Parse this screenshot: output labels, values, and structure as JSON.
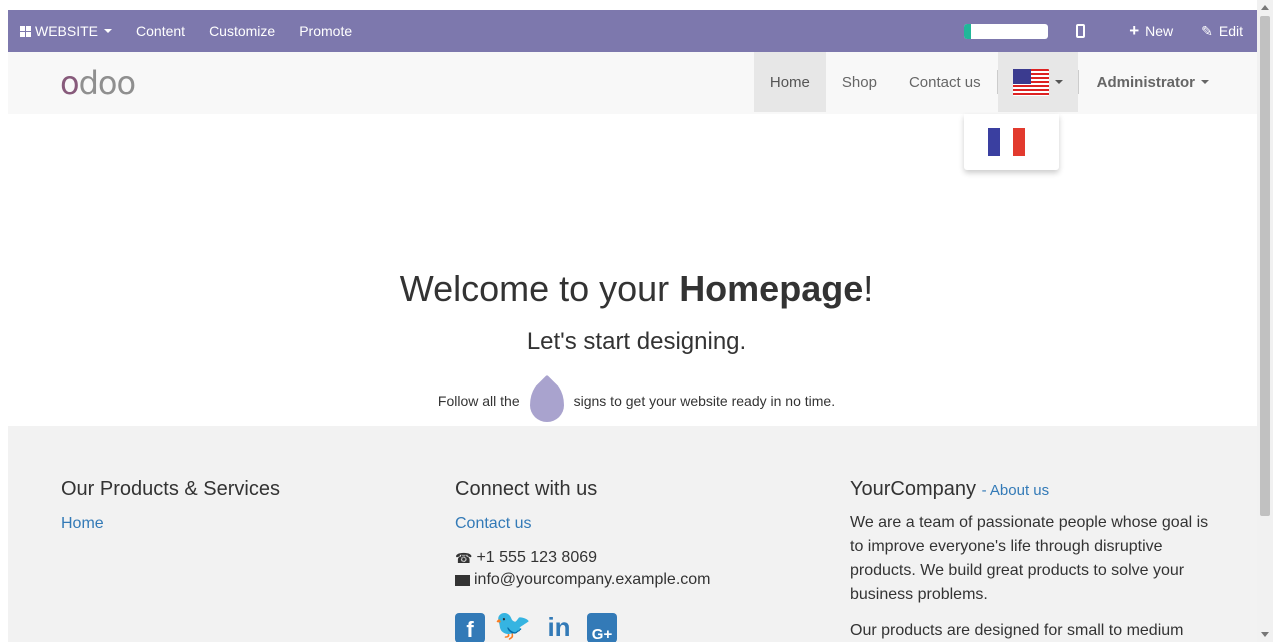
{
  "adminbar": {
    "website_label": "WEBSITE",
    "menu": [
      "Content",
      "Customize",
      "Promote"
    ],
    "progress_fraction": 0.08,
    "new_label": "New",
    "edit_label": "Edit",
    "color": "#7d78ad"
  },
  "navbar": {
    "logo_text": "odoo",
    "links": [
      "Home",
      "Shop",
      "Contact us"
    ],
    "active_link": "Home",
    "current_language_flag": "flag-us-icon",
    "user_label": "Administrator"
  },
  "language_dropdown": {
    "options": [
      "flag-fr-icon"
    ]
  },
  "hero": {
    "title_prefix": "Welcome to your ",
    "title_bold": "Homepage",
    "title_suffix": "!",
    "subtitle": "Let's start designing.",
    "hint_before": "Follow all the",
    "hint_after": "signs to get your website ready in no time."
  },
  "footer": {
    "col1": {
      "heading": "Our Products & Services",
      "links": [
        "Home"
      ]
    },
    "col2": {
      "heading": "Connect with us",
      "contact_link": "Contact us",
      "phone": "+1 555 123 8069",
      "email": "info@yourcompany.example.com",
      "socials": [
        "facebook-icon",
        "twitter-icon",
        "linkedin-icon",
        "google-plus-icon"
      ]
    },
    "col3": {
      "company": "YourCompany",
      "about_link": "- About us",
      "paragraph1": "We are a team of passionate people whose goal is to improve everyone's life through disruptive products. We build great products to solve your business problems.",
      "paragraph2": "Our products are designed for small to medium"
    },
    "link_color": "#337ab7"
  }
}
